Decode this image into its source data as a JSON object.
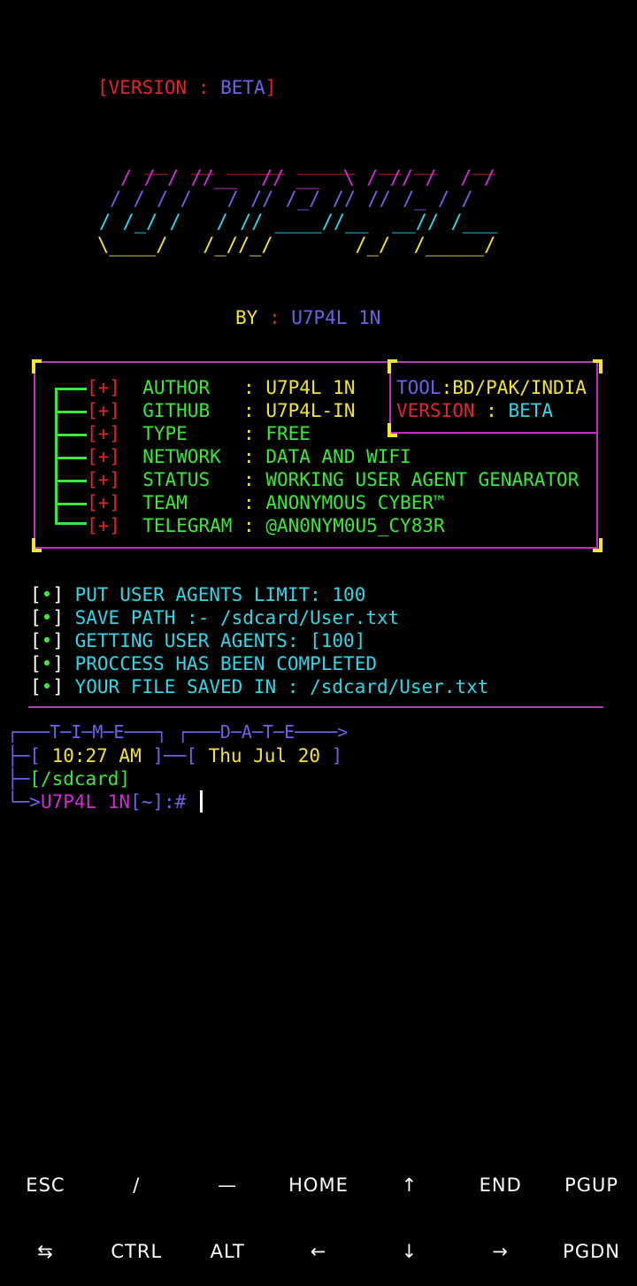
{
  "version_line": {
    "open": "[",
    "label": "VERSION",
    "sep": " : ",
    "value": "BETA",
    "close": "]"
  },
  "logo": {
    "line1": " __  __ _____ _____  __ __   __",
    "line2": "/ / / //__  // __  \\ / // /  / /",
    "line3": "/ / / /   / // /_/ // // /_ / /",
    "line4": "/ /_/ /   / // ____//__  __// /___",
    "line5": "\\____/   /_//_/       /_/  /_____/"
  },
  "by_line": {
    "label": "BY",
    "sep": " : ",
    "value": "U7P4L 1N"
  },
  "info": [
    {
      "bullet": "[+]",
      "key": "AUTHOR  ",
      "value": "U7P4L 1N"
    },
    {
      "bullet": "[+]",
      "key": "GITHUB  ",
      "value": "U7P4L-IN"
    },
    {
      "bullet": "[+]",
      "key": "TYPE    ",
      "value": "FREE"
    },
    {
      "bullet": "[+]",
      "key": "NETWORK ",
      "value": "DATA AND WIFI"
    },
    {
      "bullet": "[+]",
      "key": "STATUS  ",
      "value": "WORKING USER AGENT GENARATOR"
    },
    {
      "bullet": "[+]",
      "key": "TEAM    ",
      "value": "ANONYMOUS CYBER™"
    },
    {
      "bullet": "[+]",
      "key": "TELEGRAM",
      "value": "@AN0NYM0U5_CY83R"
    }
  ],
  "info_sep": " : ",
  "tool_box": {
    "tool_label": "TOOL",
    "tool_sep": ":",
    "tool_value": "BD/PAK/INDIA",
    "version_label": "VERSION",
    "version_sep": " : ",
    "version_value": "BETA"
  },
  "log": [
    {
      "bullet": "•",
      "text": "PUT USER AGENTS LIMIT: 100"
    },
    {
      "bullet": "•",
      "text": "SAVE PATH :- /sdcard/User.txt"
    },
    {
      "bullet": "•",
      "text": "GETTING USER AGENTS: [100]"
    },
    {
      "bullet": "•",
      "text": "PROCCESS HAS BEEN COMPLETED"
    },
    {
      "bullet": "•",
      "text": "YOUR FILE SAVED IN : /sdcard/User.txt"
    }
  ],
  "prompt": {
    "header": "┌───T─I─M─E───┐ ┌───D─A─T─E────>",
    "time_open": "├─[ ",
    "time": "10:27 AM",
    "time_close": " ]──[ ",
    "date": "Thu Jul 20",
    "date_close": " ]",
    "dir_prefix": "├─",
    "dir": "[/sdcard]",
    "user_prefix": "└─>",
    "user": "U7P4L 1N",
    "path": "[~]:#"
  },
  "keys_row1": [
    "ESC",
    "/",
    "—",
    "HOME",
    "↑",
    "END",
    "PGUP"
  ],
  "keys_row2": [
    "⇆",
    "CTRL",
    "ALT",
    "←",
    "↓",
    "→",
    "PGDN"
  ]
}
